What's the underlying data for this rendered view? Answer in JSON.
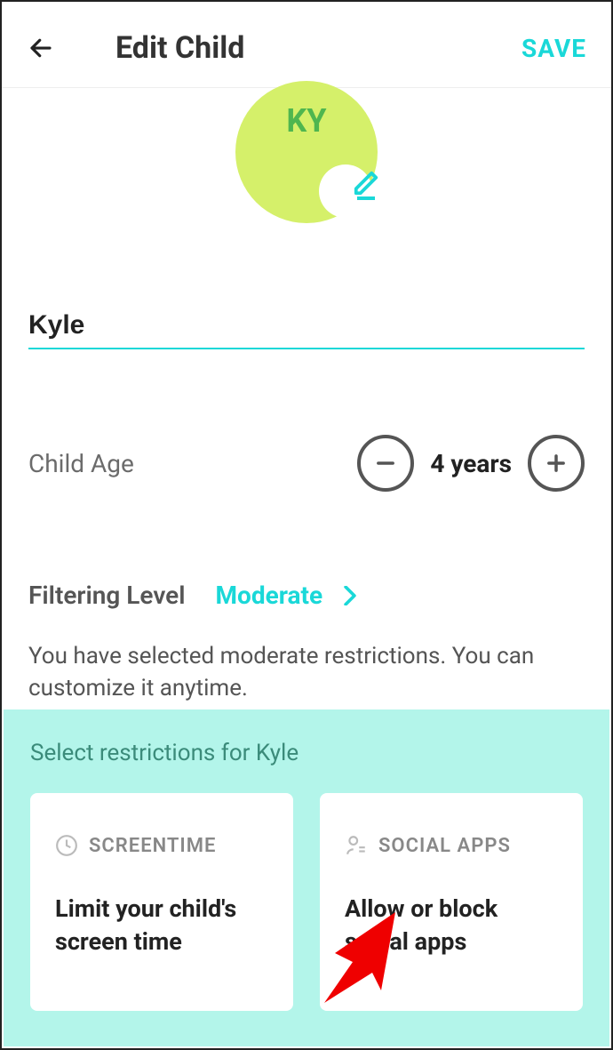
{
  "header": {
    "title": "Edit Child",
    "save_label": "SAVE"
  },
  "avatar": {
    "initials": "KY"
  },
  "name": {
    "value": "Kyle"
  },
  "age": {
    "label": "Child Age",
    "value": "4 years"
  },
  "filtering": {
    "label": "Filtering Level",
    "value": "Moderate",
    "description": "You have selected moderate restrictions. You can customize it anytime."
  },
  "restrictions": {
    "title": "Select restrictions for Kyle",
    "cards": [
      {
        "head": "SCREENTIME",
        "body": "Limit your child's screen time"
      },
      {
        "head": "SOCIAL APPS",
        "body": "Allow or block social apps"
      }
    ]
  }
}
